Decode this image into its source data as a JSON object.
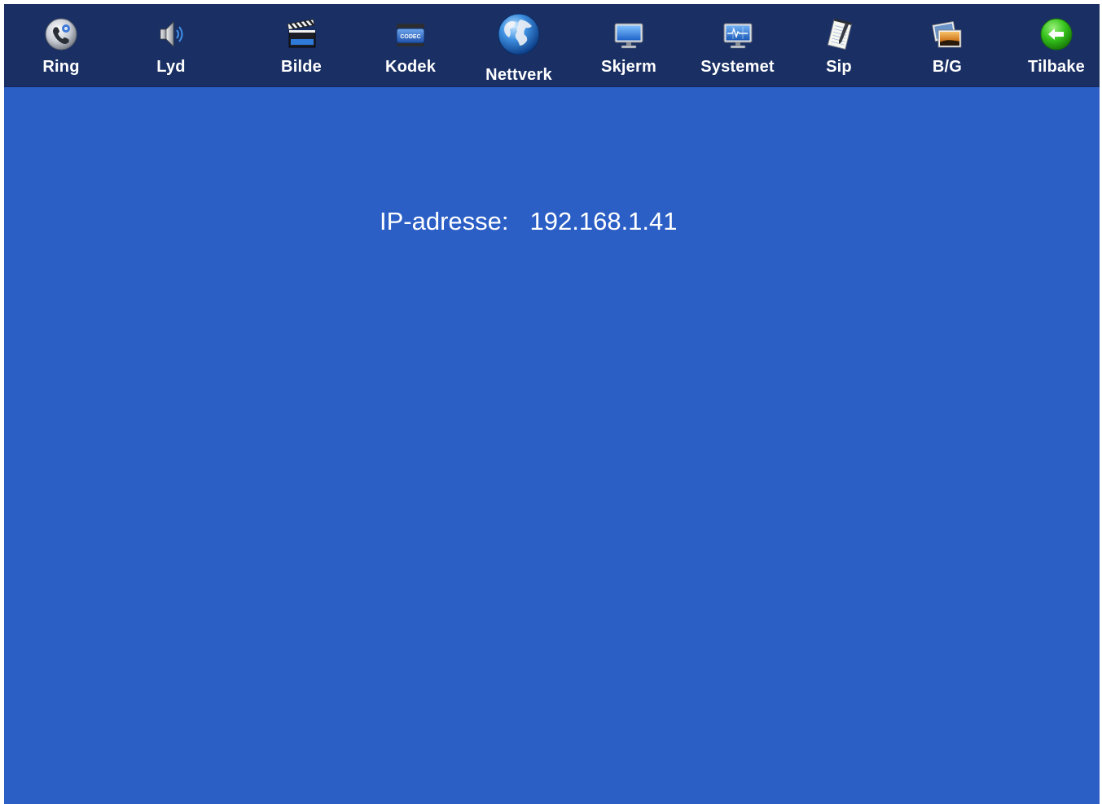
{
  "toolbar": {
    "items": [
      {
        "label": "Ring",
        "icon": "phone-gear-icon"
      },
      {
        "label": "Lyd",
        "icon": "speaker-icon"
      },
      {
        "label": "Bilde",
        "icon": "clapperboard-icon"
      },
      {
        "label": "Kodek",
        "icon": "codec-icon"
      },
      {
        "label": "Nettverk",
        "icon": "globe-icon"
      },
      {
        "label": "Skjerm",
        "icon": "monitor-icon"
      },
      {
        "label": "Systemet",
        "icon": "system-monitor-icon"
      },
      {
        "label": "Sip",
        "icon": "notepad-icon"
      },
      {
        "label": "B/G",
        "icon": "pictures-icon"
      },
      {
        "label": "Tilbake",
        "icon": "back-arrow-icon"
      }
    ],
    "codec_text": "CODEC",
    "active": "Nettverk"
  },
  "network": {
    "ip_label": "IP-adresse:",
    "ip_value": "192.168.1.41"
  },
  "colors": {
    "toolbar_bg": "#1a3064",
    "content_bg": "#2b5fc6",
    "text": "#ffffff"
  }
}
